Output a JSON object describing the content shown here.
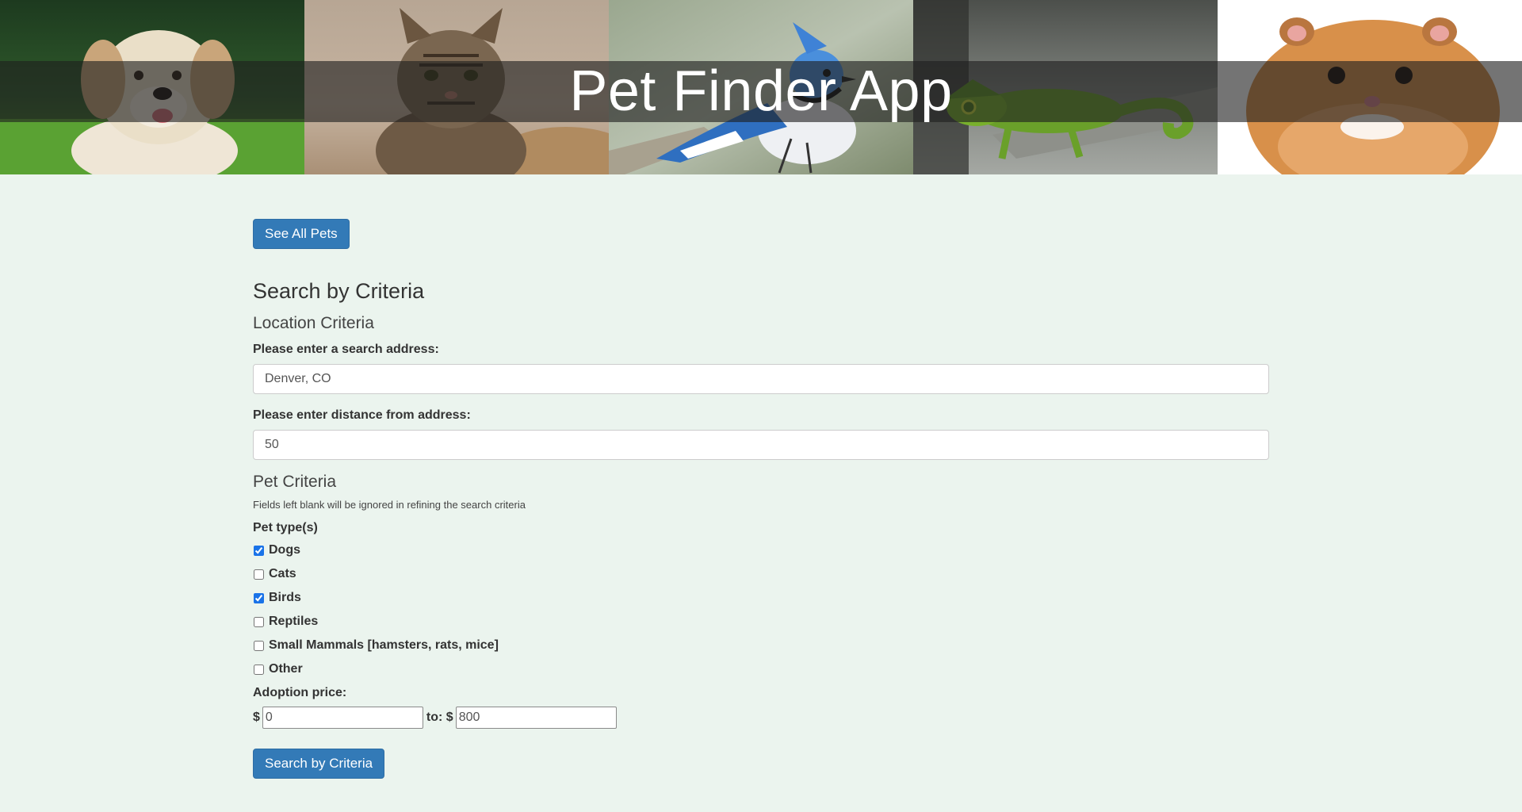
{
  "header": {
    "title": "Pet Finder App",
    "images": [
      {
        "icon": "dog-photo"
      },
      {
        "icon": "cat-photo"
      },
      {
        "icon": "blue-jay-photo"
      },
      {
        "icon": "chameleon-photo"
      },
      {
        "icon": "hamster-photo"
      }
    ]
  },
  "actions": {
    "see_all_label": "See All Pets"
  },
  "search": {
    "heading": "Search by Criteria",
    "location": {
      "heading": "Location Criteria",
      "address_label": "Please enter a search address:",
      "address_value": "Denver, CO",
      "distance_label": "Please enter distance from address:",
      "distance_value": "50"
    },
    "pet": {
      "heading": "Pet Criteria",
      "hint": "Fields left blank will be ignored in refining the search criteria",
      "types_label": "Pet type(s)",
      "types": [
        {
          "label": "Dogs",
          "checked": true
        },
        {
          "label": "Cats",
          "checked": false
        },
        {
          "label": "Birds",
          "checked": true
        },
        {
          "label": "Reptiles",
          "checked": false
        },
        {
          "label": "Small Mammals [hamsters, rats, mice]",
          "checked": false
        },
        {
          "label": "Other",
          "checked": false
        }
      ],
      "price_label": "Adoption price:",
      "currency": "$",
      "to_label": "to: $",
      "price_min": "0",
      "price_max": "800"
    },
    "submit_label": "Search by Criteria"
  },
  "colors": {
    "background": "#ebf4ee",
    "button": "#337ab7",
    "checkbox_accent": "#1a73e8"
  }
}
